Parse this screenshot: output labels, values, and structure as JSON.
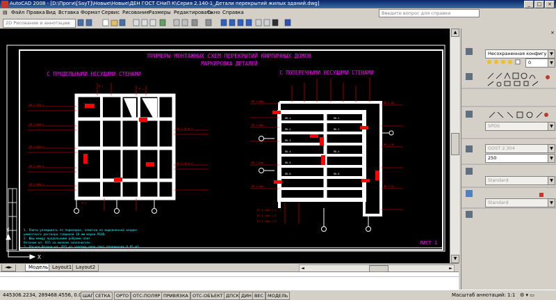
{
  "window": {
    "title": "AutoCAD 2008 - [D:\\Проги\\[SayT]\\Новые\\Новые\\ДЕН ГОСТ СНиП К\\Серия 2.140-1_Детали перекрытий жилых зданий.dwg]",
    "help_placeholder": "Введите вопрос для справки",
    "controls": [
      "_",
      "□",
      "×"
    ]
  },
  "menu": {
    "items": [
      "Файл",
      "Правка",
      "Вид",
      "Вставка",
      "Формат",
      "Сервис",
      "Рисование",
      "Размеры",
      "Редактировать",
      "Окно",
      "Справка"
    ]
  },
  "toolbar": {
    "workspace": "2D Рисование и аннотации"
  },
  "drawing": {
    "title_line1": "ПРИМЕРЫ МОНТАЖНЫХ СХЕМ ПЕРЕКРЫТИЙ КИРПИЧНЫХ ДОМОВ",
    "title_line2": "МАРКИРОВКА ДЕТАЛЕЙ",
    "left_caption": "С ПРОДОЛЬНЫМИ НЕСУЩИМИ СТЕНАМИ",
    "right_caption": "С ПОПЕРЕЧНЫМИ НЕСУЩИМИ СТЕНАМИ",
    "sheet_label": "ЛИСТ 1",
    "axis_x": "X",
    "axis_y": "Y",
    "notes": [
      "1. Плиты укладывать по подкладке, отметки на выровненной кладке",
      "цементного раствора толщиной 10 мм марки М100.",
      "2. Швы между продольными ребрами плит",
      "бетоном кл. В15 на мелком заполнителе.",
      "3. Расход бетона кл. В15 на заделку швов плит перекрытия 0.05 м3."
    ]
  },
  "layout_tabs": {
    "items": [
      "Модель",
      "Layout1",
      "Layout2"
    ],
    "active": "Модель"
  },
  "status": {
    "coordinates": "445306.2234, 289468.4556, 0.0000",
    "buttons": [
      "ШАГ",
      "СЕТКА",
      "ОРТО",
      "ОТС-ПОЛЯР",
      "ПРИВЯЗКА",
      "ОТС-ОБЪЕКТ",
      "ДПСК",
      "ДИН",
      "ВЕС",
      "МОДЕЛЬ"
    ],
    "scale_label": "Масштаб аннотаций:",
    "scale_value": "1:1"
  },
  "dashboard": {
    "config_combo": "Несохраненная конфигу",
    "layer_value": "0",
    "dimstyle_combo": "SPDS",
    "textstyle_combo": "GOST 2.304",
    "text_height_combo": "250",
    "multileader_combo": "Standard",
    "table_combo": "Standard"
  },
  "colors": {
    "canvas": "#000000",
    "structure": "#ffffff",
    "annotation": "#ff0000",
    "title_text": "#ff00ff",
    "notes_text": "#00ffff",
    "window_chrome": "#d4d0c8"
  }
}
